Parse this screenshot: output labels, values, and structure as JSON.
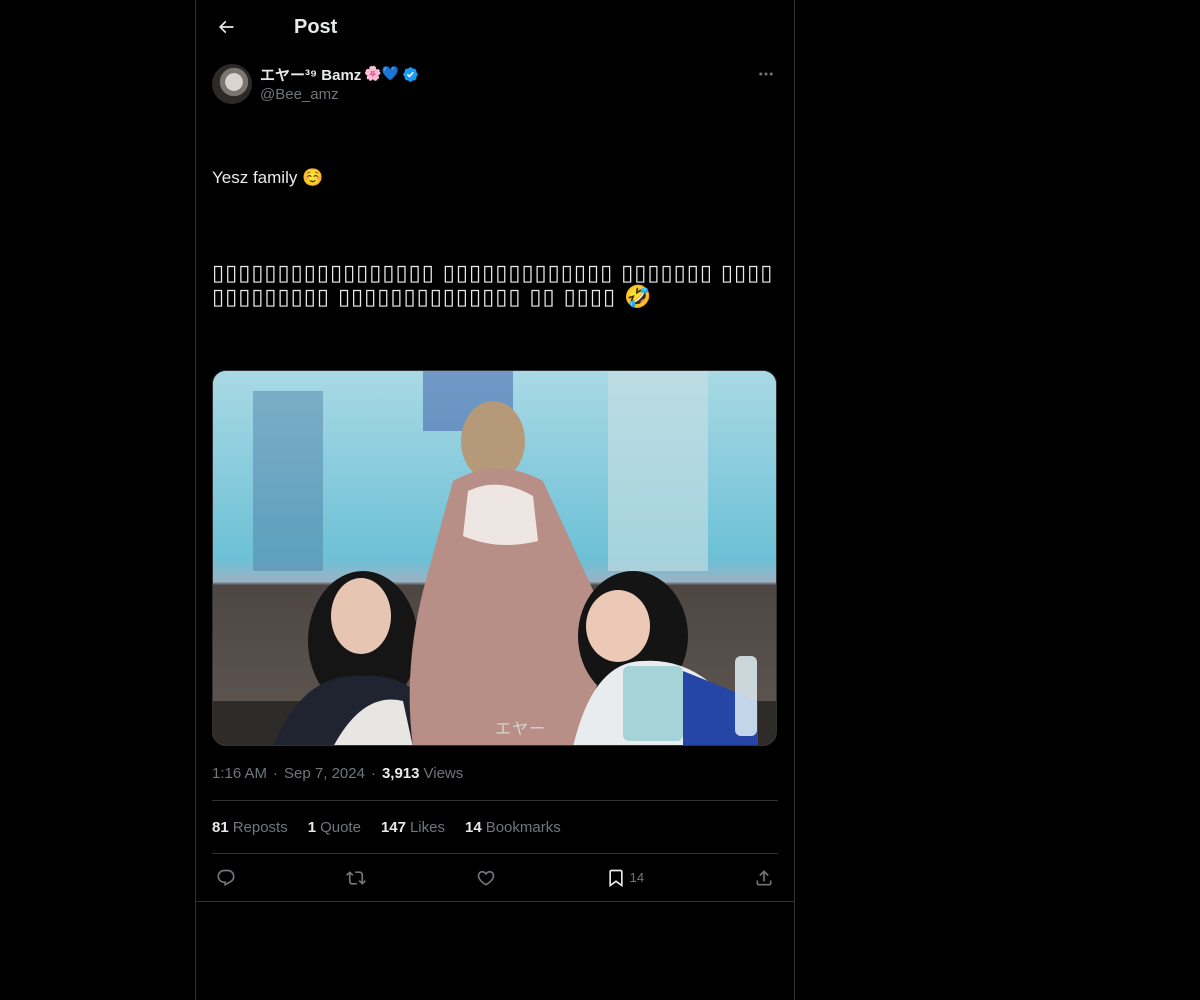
{
  "header": {
    "title": "Post"
  },
  "post": {
    "author": {
      "display_name": "エヤー³⁹ Bamz",
      "name_emojis": "🌸💙",
      "handle": "@Bee_amz"
    },
    "text_line_1": "Yesz family ☺️",
    "text_line_2": "▯▯▯▯▯▯▯▯▯▯▯▯▯▯▯▯▯ ▯▯▯▯▯▯▯▯▯▯▯▯▯ ▯▯▯▯▯▯▯ ▯▯▯▯▯▯▯▯▯▯▯▯▯ ▯▯▯▯▯▯▯▯▯▯▯▯▯▯ ▯▯ ▯▯▯▯ 🤣",
    "image_watermark": "エヤー",
    "time": "1:16 AM",
    "date": "Sep 7, 2024",
    "views_count": "3,913",
    "views_label": "Views"
  },
  "stats": [
    {
      "num": "81",
      "label": "Reposts"
    },
    {
      "num": "1",
      "label": "Quote"
    },
    {
      "num": "147",
      "label": "Likes"
    },
    {
      "num": "14",
      "label": "Bookmarks"
    }
  ],
  "actions": {
    "bookmark_count": "14"
  },
  "colors": {
    "background": "#000000",
    "text_primary": "#e7e9ea",
    "text_secondary": "#71767b",
    "border": "#2f3336",
    "verified": "#1d9bf0"
  },
  "icons": [
    "back-arrow-icon",
    "more-icon",
    "verified-badge-icon",
    "reply-icon",
    "repost-icon",
    "like-icon",
    "bookmark-icon",
    "share-icon"
  ]
}
